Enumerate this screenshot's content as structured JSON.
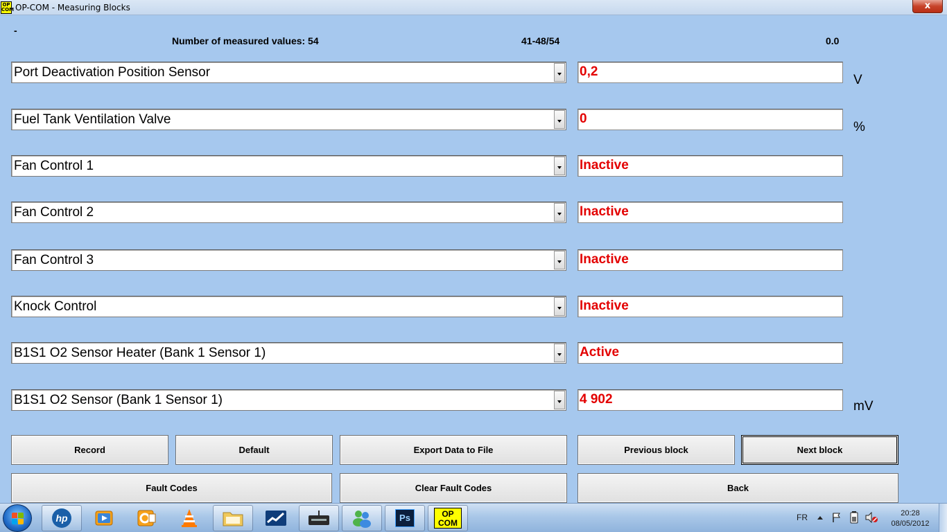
{
  "window": {
    "app_icon_text_top": "OP",
    "app_icon_text_bottom": "COM",
    "title": "OP-COM - Measuring Blocks",
    "close_label": "x"
  },
  "header": {
    "dash": "-",
    "count_text": "Number of measured values: 54",
    "range_text": "41-48/54",
    "timer_text": "0.0"
  },
  "rows": [
    {
      "name": "Port Deactivation Position Sensor",
      "value": "0,2",
      "unit": "V"
    },
    {
      "name": "Fuel Tank Ventilation Valve",
      "value": "0",
      "unit": "%"
    },
    {
      "name": "Fan Control 1",
      "value": "Inactive",
      "unit": ""
    },
    {
      "name": "Fan Control 2",
      "value": "Inactive",
      "unit": ""
    },
    {
      "name": "Fan Control 3",
      "value": "Inactive",
      "unit": ""
    },
    {
      "name": "Knock Control",
      "value": "Inactive",
      "unit": ""
    },
    {
      "name": "B1S1 O2 Sensor Heater (Bank 1 Sensor 1)",
      "value": "Active",
      "unit": ""
    },
    {
      "name": "B1S1 O2 Sensor (Bank 1 Sensor 1)",
      "value": "4 902",
      "unit": "mV"
    }
  ],
  "buttons": {
    "record": "Record",
    "default": "Default",
    "export": "Export Data to File",
    "previous": "Previous block",
    "next": "Next block",
    "fault_codes": "Fault Codes",
    "clear_fault_codes": "Clear Fault Codes",
    "back": "Back"
  },
  "taskbar": {
    "items": [
      "windows-start",
      "hp",
      "media-player",
      "outlook",
      "vlc",
      "file-explorer",
      "stocks-app",
      "network-app",
      "messenger",
      "photoshop",
      "op-com"
    ],
    "photoshop_label": "Ps",
    "opcom_top": "OP",
    "opcom_bottom": "COM",
    "language": "FR",
    "time": "20:28",
    "date": "08/05/2012"
  },
  "colors": {
    "background": "#a6c8ee",
    "value_text": "#e30000",
    "opcom_yellow": "#ffff00"
  }
}
